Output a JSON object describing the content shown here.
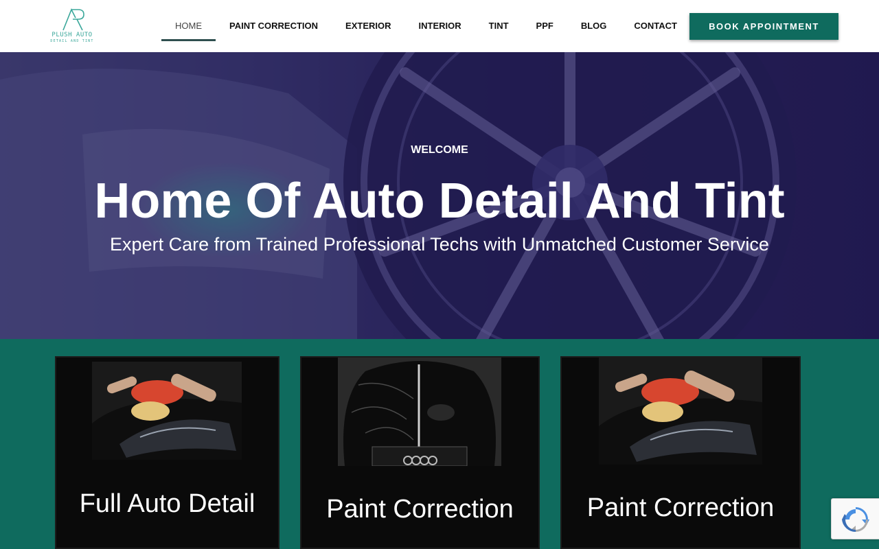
{
  "brand": {
    "name": "PLUSH AUTO",
    "tagline": "DETAIL AND TINT",
    "accent": "#0f6b5e",
    "logo_icon": "pa-monogram-icon"
  },
  "nav": {
    "items": [
      {
        "label": "HOME",
        "active": true
      },
      {
        "label": "PAINT CORRECTION"
      },
      {
        "label": "EXTERIOR"
      },
      {
        "label": "INTERIOR"
      },
      {
        "label": "TINT"
      },
      {
        "label": "PPF"
      },
      {
        "label": "BLOG"
      },
      {
        "label": "CONTACT"
      }
    ],
    "cta_label": "BOOK APPOINTMENT"
  },
  "hero": {
    "eyebrow": "WELCOME",
    "title": "Home Of Auto Detail And Tint",
    "subtitle": "Expert Care from Trained Professional Techs with Unmatched Customer Service"
  },
  "cards": [
    {
      "title": "Full Auto Detail",
      "image": "polisher-on-headlight-image"
    },
    {
      "title": "Paint Correction",
      "image": "car-hood-before-after-image"
    },
    {
      "title": "Paint Correction",
      "image": "polisher-on-headlight-image"
    }
  ],
  "widgets": {
    "recaptcha_icon": "recaptcha-icon"
  }
}
